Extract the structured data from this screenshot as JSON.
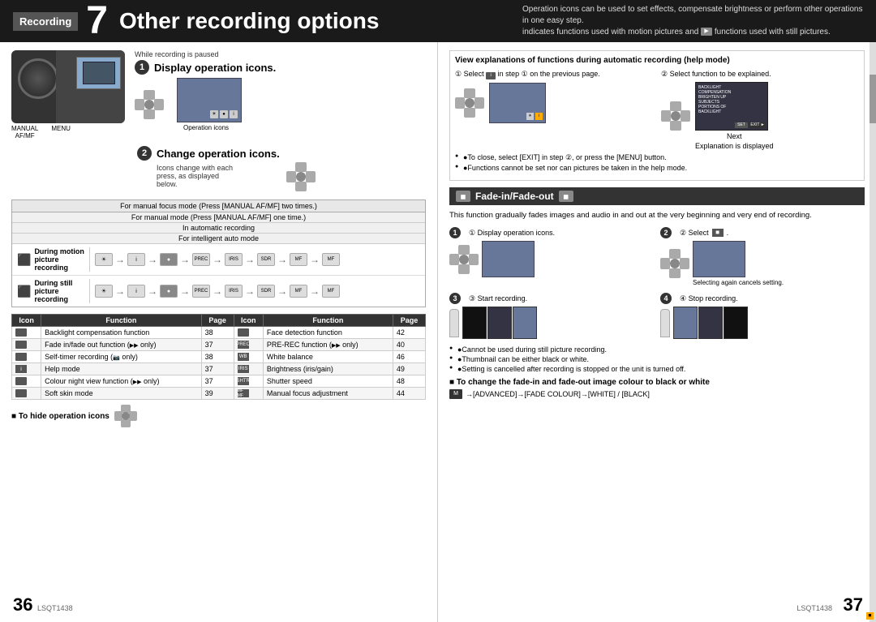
{
  "header": {
    "recording_label": "Recording",
    "number": "7",
    "title": "Other recording options",
    "desc_line1": "Operation icons can be used to set effects, compensate brightness or perform other operations in one easy step.",
    "desc_line2": "indicates functions used with motion pictures and",
    "desc_line3": "functions used with still pictures."
  },
  "left": {
    "while_recording": "While recording is paused",
    "step1_title": "Display operation icons.",
    "step2_title": "Change operation icons.",
    "step2_desc1": "Icons change with each",
    "step2_desc2": "press, as displayed",
    "step2_desc3": "below.",
    "op_icons_label": "Operation icons",
    "manual_af_mf": "MANUAL\nAF/MF",
    "menu": "MENU",
    "for_manual_focus": "For manual focus mode (Press [MANUAL AF/MF] two times.)",
    "for_manual_mode": "For manual mode (Press [MANUAL AF/MF] one time.)",
    "in_automatic": "In automatic recording",
    "for_intelligent": "For intelligent auto mode",
    "motion_label": "During motion picture recording",
    "still_label": "During still picture recording",
    "table": {
      "headers": [
        "Icon",
        "Function",
        "Page",
        "Icon",
        "Function",
        "Page"
      ],
      "rows": [
        [
          "",
          "Backlight compensation function",
          "38",
          "",
          "Face detection function",
          "42"
        ],
        [
          "",
          "Fade in/fade out function (   only)",
          "37",
          "PREC",
          "PRE-REC function (   only)",
          "40"
        ],
        [
          "",
          "Self-timer recording (   only)",
          "38",
          "WB",
          "White balance",
          "46"
        ],
        [
          "i",
          "Help mode",
          "37",
          "IRIS",
          "Brightness (iris/gain)",
          "49"
        ],
        [
          "",
          "Colour night view function (   only)",
          "37",
          "SHTR",
          "Shutter speed",
          "48"
        ],
        [
          "",
          "Soft skin mode",
          "39",
          "MF MF",
          "Manual focus adjustment",
          "44"
        ]
      ]
    },
    "hide_note": "■ To hide operation icons"
  },
  "right": {
    "help_title": "View explanations of functions during automatic recording (help mode)",
    "step1_label": "① Select",
    "step1_desc": "in step ① on the previous page.",
    "step2_label": "② Select function to be explained.",
    "next_label": "Next",
    "explanation_label": "Explanation is displayed",
    "bullet1": "●To close, select [EXIT] in step ②, or press the [MENU] button.",
    "bullet2": "●Functions cannot be set nor can pictures be taken in the help mode.",
    "fade_title": "Fade-in/Fade-out",
    "fade_desc": "This function gradually fades images and audio in and out at the very beginning and very end of recording.",
    "step1_fade": "① Display operation icons.",
    "step2_fade": "② Select",
    "step2_fade_suffix": ".",
    "selecting_cancels": "Selecting again cancels setting.",
    "step3_fade": "③ Start recording.",
    "step4_fade": "④ Stop recording.",
    "fade_bullet1": "●Cannot be used during still picture recording.",
    "fade_bullet2": "●Thumbnail can be either black or white.",
    "fade_bullet3": "●Setting is cancelled after recording is stopped or the unit is turned off.",
    "black_white_title": "■ To change the fade-in and fade-out image colour to black or white",
    "black_white_nav": "→[ADVANCED]→[FADE COLOUR]→[WHITE] / [BLACK]",
    "menu_label": "MENU"
  },
  "footer": {
    "page_left": "36",
    "code_left": "LSQT1438",
    "page_right": "37",
    "code_right": "LSQT1438"
  }
}
